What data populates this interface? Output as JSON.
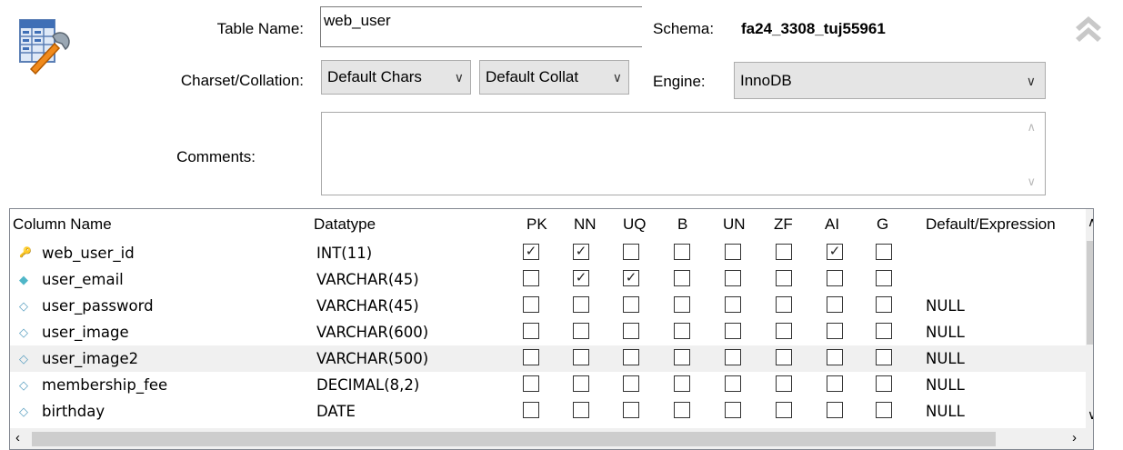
{
  "form": {
    "table_name_label": "Table Name:",
    "table_name_value": "web_user",
    "schema_label": "Schema:",
    "schema_value": "fa24_3308_tuj55961",
    "charset_label": "Charset/Collation:",
    "charset_value": "Default Chars",
    "collation_value": "Default Collat",
    "engine_label": "Engine:",
    "engine_value": "InnoDB",
    "comments_label": "Comments:",
    "comments_value": ""
  },
  "icons": {
    "table_editor": "table-wrench-icon",
    "collapse": "double-chevron-up-icon",
    "dropdown": "chevron-down-icon"
  },
  "grid": {
    "headers": {
      "column_name": "Column Name",
      "datatype": "Datatype",
      "pk": "PK",
      "nn": "NN",
      "uq": "UQ",
      "b": "B",
      "un": "UN",
      "zf": "ZF",
      "ai": "AI",
      "g": "G",
      "default": "Default/Expression"
    },
    "rows": [
      {
        "name": "web_user_id",
        "type": "INT(11)",
        "key": "primary",
        "pk": true,
        "nn": true,
        "uq": false,
        "b": false,
        "un": false,
        "zf": false,
        "ai": true,
        "g": false,
        "default": ""
      },
      {
        "name": "user_email",
        "type": "VARCHAR(45)",
        "key": "not-null",
        "pk": false,
        "nn": true,
        "uq": true,
        "b": false,
        "un": false,
        "zf": false,
        "ai": false,
        "g": false,
        "default": ""
      },
      {
        "name": "user_password",
        "type": "VARCHAR(45)",
        "key": "nullable",
        "pk": false,
        "nn": false,
        "uq": false,
        "b": false,
        "un": false,
        "zf": false,
        "ai": false,
        "g": false,
        "default": "NULL"
      },
      {
        "name": "user_image",
        "type": "VARCHAR(600)",
        "key": "nullable",
        "pk": false,
        "nn": false,
        "uq": false,
        "b": false,
        "un": false,
        "zf": false,
        "ai": false,
        "g": false,
        "default": "NULL"
      },
      {
        "name": "user_image2",
        "type": "VARCHAR(500)",
        "key": "nullable",
        "pk": false,
        "nn": false,
        "uq": false,
        "b": false,
        "un": false,
        "zf": false,
        "ai": false,
        "g": false,
        "default": "NULL"
      },
      {
        "name": "membership_fee",
        "type": "DECIMAL(8,2)",
        "key": "nullable",
        "pk": false,
        "nn": false,
        "uq": false,
        "b": false,
        "un": false,
        "zf": false,
        "ai": false,
        "g": false,
        "default": "NULL"
      },
      {
        "name": "birthday",
        "type": "DATE",
        "key": "nullable",
        "pk": false,
        "nn": false,
        "uq": false,
        "b": false,
        "un": false,
        "zf": false,
        "ai": false,
        "g": false,
        "default": "NULL"
      }
    ]
  },
  "colors": {
    "key_icon": "#e8b800",
    "not_null_icon": "#4fb6c8",
    "nullable_icon": "#5a9fc0",
    "selected_row": "#f0f0f0",
    "scrollbar_thumb": "#cdcdcd"
  }
}
